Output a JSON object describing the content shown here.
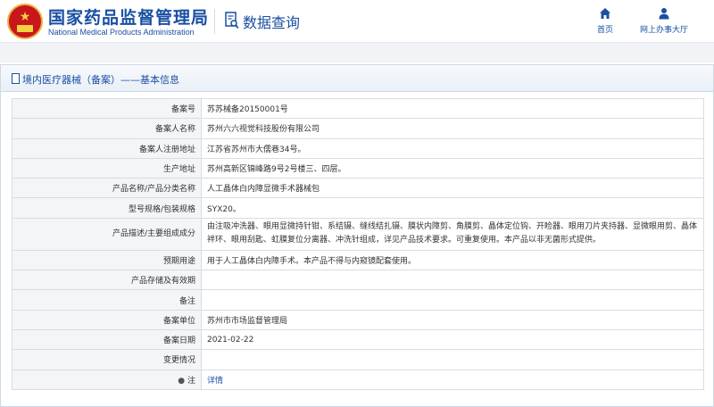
{
  "header": {
    "brand_cn": "国家药品监督管理局",
    "brand_en": "National Medical Products Administration",
    "query_title": "数据查询",
    "nav": [
      {
        "label": "首页",
        "icon": "home-icon"
      },
      {
        "label": "网上办事大厅",
        "icon": "user-icon"
      }
    ]
  },
  "panel": {
    "title": "境内医疗器械（备案）——基本信息"
  },
  "records": [
    {
      "label": "备案号",
      "value": "苏苏械备20150001号"
    },
    {
      "label": "备案人名称",
      "value": "苏州六六视觉科技股份有限公司"
    },
    {
      "label": "备案人注册地址",
      "value": "江苏省苏州市大儒巷34号。"
    },
    {
      "label": "生产地址",
      "value": "苏州高新区锦峰路9号2号楼三、四层。"
    },
    {
      "label": "产品名称/产品分类名称",
      "value": "人工晶体白内障显微手术器械包"
    },
    {
      "label": "型号规格/包装规格",
      "value": "SYX20。"
    },
    {
      "label": "产品描述/主要组成成分",
      "value": "由注吸冲洗器、眼用显微持针钳、系结镊、缝线结扎镊、膜状内障剪、角膜剪、晶体定位钩、开睑器、眼用刀片夹持器、显微眼用剪、晶体袢环、眼用刮匙、虹膜复位分离器、冲洗针组成，详见产品技术要求。可重复使用。本产品以非无菌形式提供。"
    },
    {
      "label": "预期用途",
      "value": "用于人工晶体白内障手术。本产品不得与内窥镜配套使用。"
    },
    {
      "label": "产品存储及有效期",
      "value": ""
    },
    {
      "label": "备注",
      "value": ""
    },
    {
      "label": "备案单位",
      "value": "苏州市市场监督管理局"
    },
    {
      "label": "备案日期",
      "value": "2021-02-22"
    },
    {
      "label": "变更情况",
      "value": ""
    },
    {
      "label": "注",
      "value": "详情"
    }
  ],
  "colors": {
    "brand_blue": "#1a4fa3",
    "emblem_red": "#c8161d",
    "label_bg": "#f4f5f7"
  }
}
